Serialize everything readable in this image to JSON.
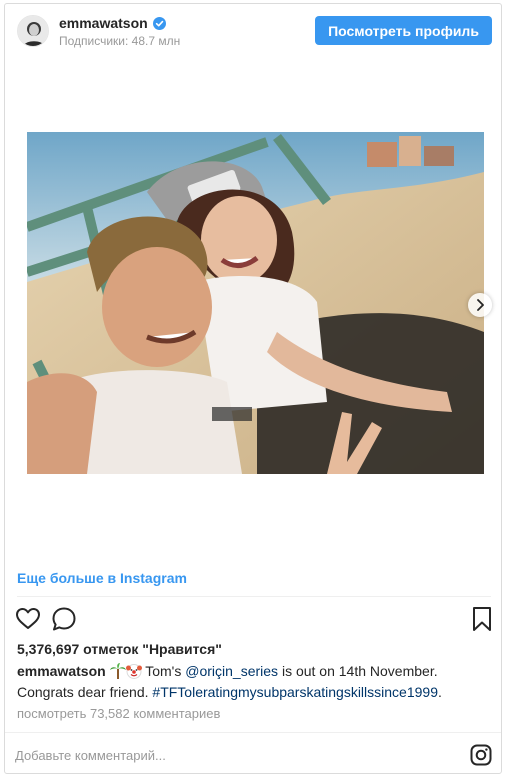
{
  "header": {
    "username": "emmawatson",
    "followers": "Подписчики: 48.7 млн",
    "view_profile_label": "Посмотреть профиль"
  },
  "more_link": "Еще больше в Instagram",
  "likes": "5,376,697 отметок \"Нравится\"",
  "caption": {
    "username": "emmawatson",
    "text_1": " Tom's ",
    "mention": "@oriçin_series",
    "text_2": " is out on 14th November. Congrats dear friend. ",
    "hashtag": "#TFToleratingmysubparskatingskillssince1999",
    "text_3": "."
  },
  "view_comments": "посмотреть 73,582 комментариев",
  "comment": {
    "placeholder": "Добавьте комментарий...",
    "value": ""
  },
  "icons": {
    "verified": "verified-badge-icon",
    "like": "heart-icon",
    "comment": "comment-bubble-icon",
    "save": "bookmark-icon",
    "next": "chevron-right-icon",
    "instagram": "instagram-logo-icon"
  },
  "colors": {
    "accent": "#3897f0",
    "link": "#003569",
    "muted": "#999999",
    "text": "#262626"
  }
}
